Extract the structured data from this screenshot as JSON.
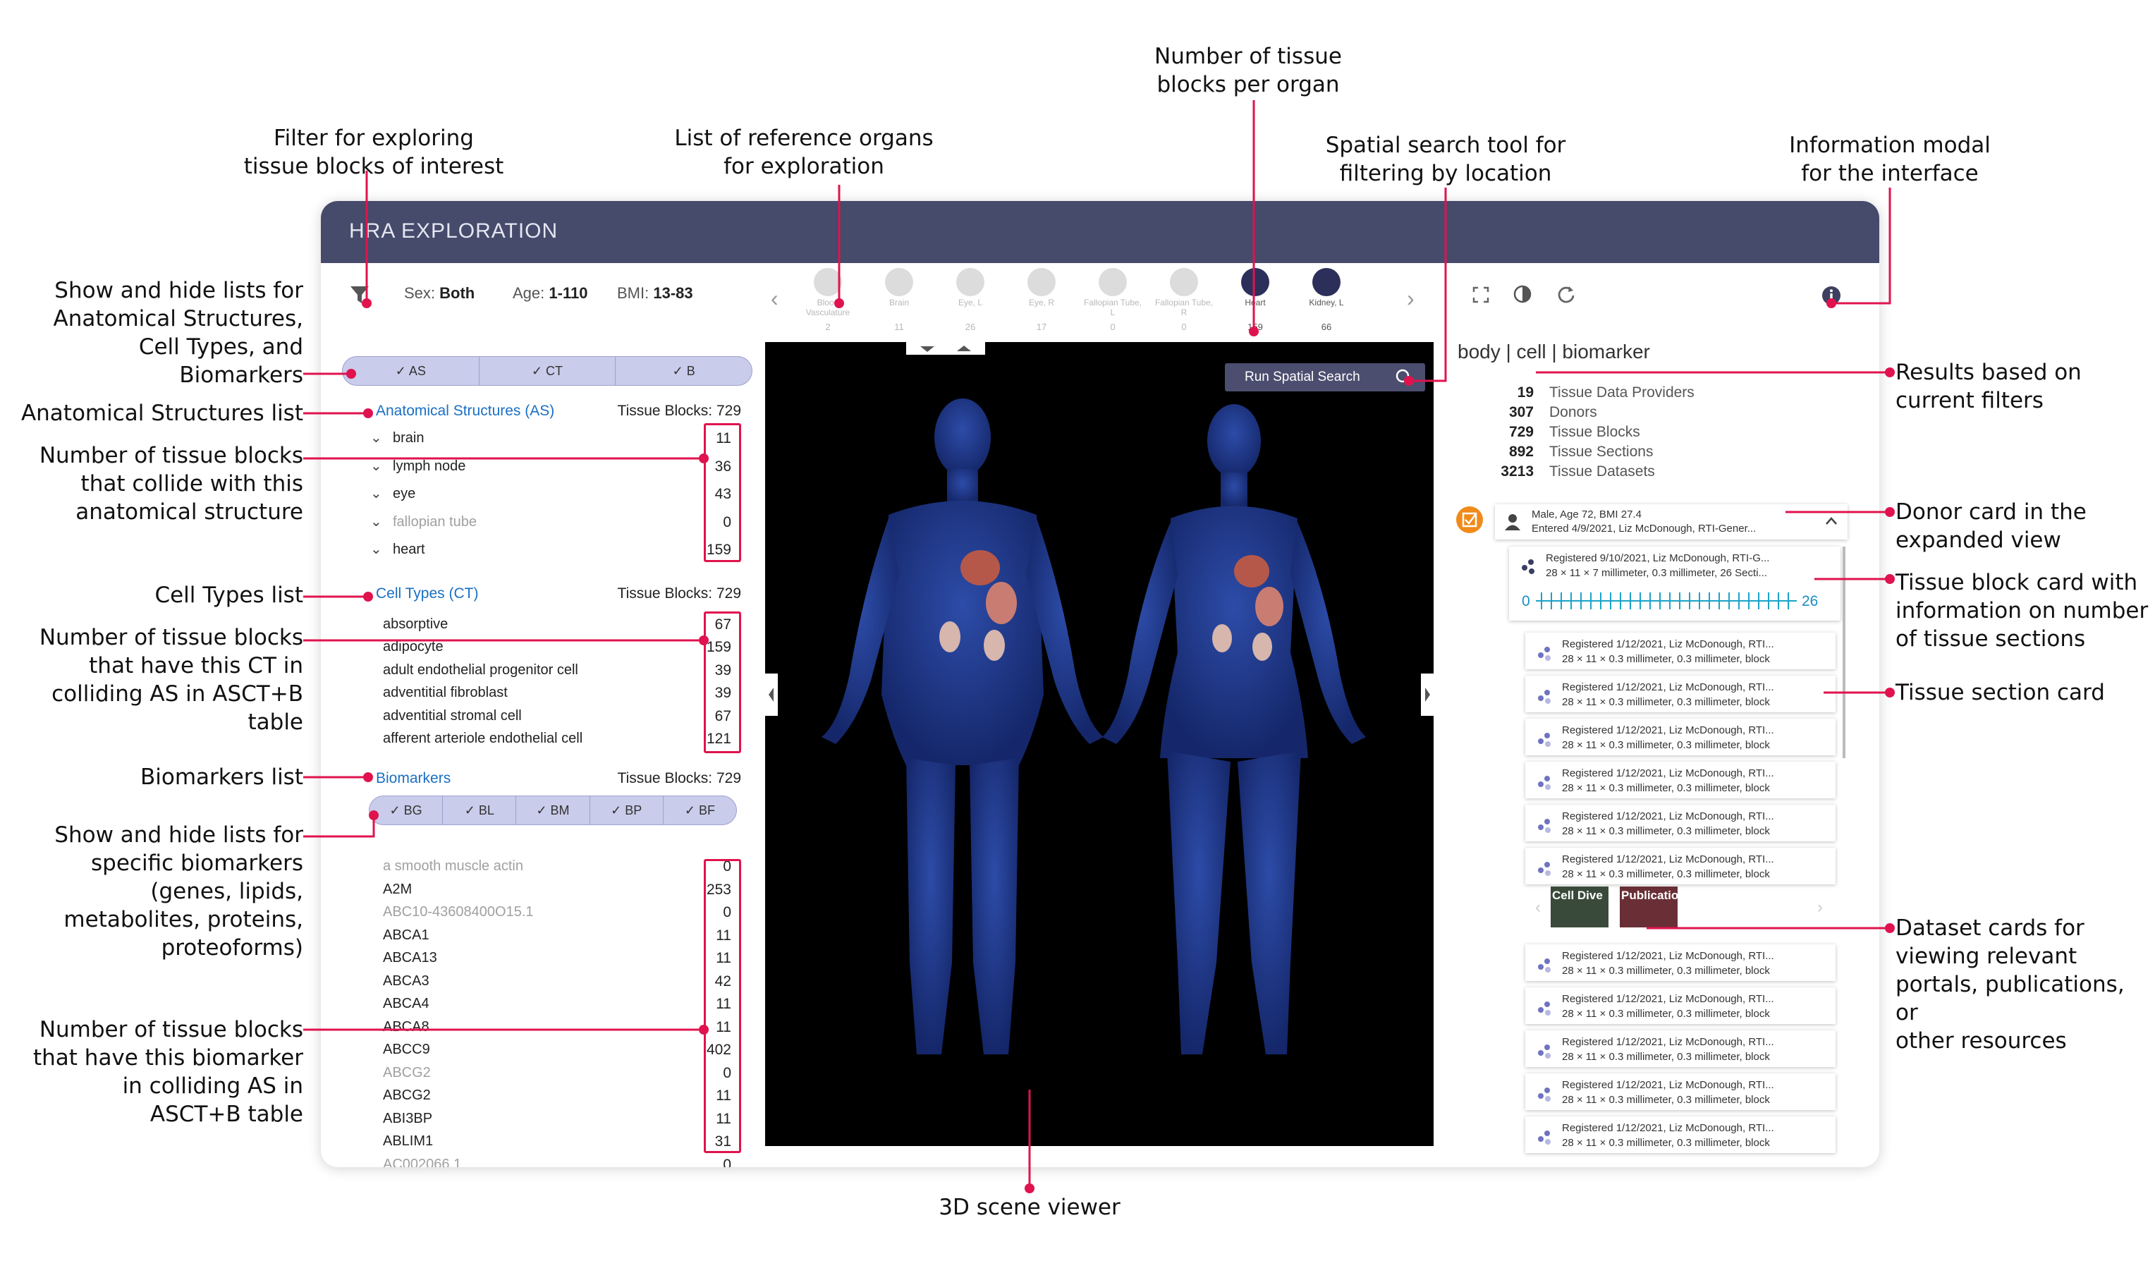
{
  "app": {
    "title": "HRA EXPLORATION"
  },
  "filters": {
    "sex_label": "Sex:",
    "sex": "Both",
    "age_label": "Age:",
    "age": "1-110",
    "bmi_label": "BMI:",
    "bmi": "13-83"
  },
  "organs": [
    {
      "name": "Blood Vasculature",
      "count": "2",
      "active": false
    },
    {
      "name": "Brain",
      "count": "11",
      "active": false
    },
    {
      "name": "Eye, L",
      "count": "26",
      "active": false
    },
    {
      "name": "Eye, R",
      "count": "17",
      "active": false
    },
    {
      "name": "Fallopian Tube, L",
      "count": "0",
      "active": false
    },
    {
      "name": "Fallopian Tube, R",
      "count": "0",
      "active": false
    },
    {
      "name": "Heart",
      "count": "159",
      "active": true
    },
    {
      "name": "Kidney, L",
      "count": "66",
      "active": true
    }
  ],
  "left": {
    "toggle_main": [
      "AS",
      "CT",
      "B"
    ],
    "as": {
      "title": "Anatomical Structures (AS)",
      "blocks": "Tissue Blocks: 729",
      "items": [
        {
          "label": "brain",
          "n": "11"
        },
        {
          "label": "lymph node",
          "n": "36"
        },
        {
          "label": "eye",
          "n": "43"
        },
        {
          "label": "fallopian tube",
          "n": "0"
        },
        {
          "label": "heart",
          "n": "159"
        }
      ]
    },
    "ct": {
      "title": "Cell Types (CT)",
      "blocks": "Tissue Blocks: 729",
      "items": [
        {
          "label": "absorptive",
          "n": "67"
        },
        {
          "label": "adipocyte",
          "n": "159"
        },
        {
          "label": "adult endothelial progenitor cell",
          "n": "39"
        },
        {
          "label": "adventitial fibroblast",
          "n": "39"
        },
        {
          "label": "adventitial stromal cell",
          "n": "67"
        },
        {
          "label": "afferent arteriole endothelial cell",
          "n": "121"
        }
      ]
    },
    "bm": {
      "title": "Biomarkers",
      "blocks": "Tissue Blocks: 729",
      "toggle": [
        "BG",
        "BL",
        "BM",
        "BP",
        "BF"
      ],
      "items": [
        {
          "label": "a smooth muscle actin",
          "n": "0"
        },
        {
          "label": "A2M",
          "n": "253"
        },
        {
          "label": "ABC10-43608400O15.1",
          "n": "0"
        },
        {
          "label": "ABCA1",
          "n": "11"
        },
        {
          "label": "ABCA13",
          "n": "11"
        },
        {
          "label": "ABCA3",
          "n": "42"
        },
        {
          "label": "ABCA4",
          "n": "11"
        },
        {
          "label": "ABCA8",
          "n": "11"
        },
        {
          "label": "ABCC9",
          "n": "402"
        },
        {
          "label": "ABCG2",
          "n": "0"
        },
        {
          "label": "ABCG2",
          "n": "11"
        },
        {
          "label": "ABI3BP",
          "n": "11"
        },
        {
          "label": "ABLIM1",
          "n": "31"
        },
        {
          "label": "AC002066.1",
          "n": "0"
        }
      ]
    }
  },
  "viewer": {
    "spatial_search": "Run Spatial Search"
  },
  "right": {
    "tabs": "body | cell | biomarker",
    "stats": [
      {
        "n": "19",
        "label": "Tissue Data Providers"
      },
      {
        "n": "307",
        "label": "Donors"
      },
      {
        "n": "729",
        "label": "Tissue Blocks"
      },
      {
        "n": "892",
        "label": "Tissue Sections"
      },
      {
        "n": "3213",
        "label": "Tissue Datasets"
      }
    ],
    "donor": {
      "line1": "Male, Age 72, BMI 27.4",
      "line2": "Entered 4/9/2021, Liz McDonough, RTI-Gener..."
    },
    "block": {
      "line1": "Registered 9/10/2021, Liz McDonough, RTI-G...",
      "line2": "28 × 11 × 7 millimeter, 0.3 millimeter, 26 Secti...",
      "min": "0",
      "max": "26"
    },
    "section": {
      "line1": "Registered 1/12/2021, Liz McDonough, RTI...",
      "line2": "28 × 11 × 0.3 millimeter, 0.3 millimeter, block"
    },
    "datasets": [
      "Cell Dive",
      "Publication"
    ]
  },
  "annotations": {
    "filter": "Filter for exploring\ntissue blocks of interest",
    "organs": "List of reference organs\nfor exploration",
    "blocks_per_organ": "Number of tissue\nblocks per organ",
    "spatial": "Spatial search tool for\nfiltering by location",
    "info": "Information modal\nfor the interface",
    "showhide": "Show and hide lists for\nAnatomical Structures,\nCell Types, and\nBiomarkers",
    "as_list": "Anatomical Structures list",
    "as_count": "Number of tissue blocks\nthat collide with this\nanatomical structure",
    "ct_list": "Cell Types list",
    "ct_count": "Number of tissue blocks\nthat have this CT in\ncolliding AS in ASCT+B\ntable",
    "bm_list": "Biomarkers list",
    "bm_showhide": "Show and hide lists for\nspecific biomarkers\n(genes, lipids,\nmetabolites, proteins,\nproteoforms)",
    "bm_count": "Number of tissue blocks\nthat have this biomarker\nin colliding AS in\nASCT+B table",
    "viewer": "3D scene viewer",
    "results": "Results based on\ncurrent filters",
    "donor": "Donor card in the\nexpanded view",
    "block": "Tissue block card with\ninformation on number\nof tissue sections",
    "section": "Tissue section card",
    "dataset": "Dataset cards for\nviewing relevant\nportals, publications, or\nother resources"
  },
  "colors": {
    "accent_red": "#e0134e",
    "titlebar": "#464a6b",
    "link_blue": "#1a6fc4",
    "body_blue": "#223a8a",
    "timeline": "#1aa3c9",
    "checkbox": "#f08a1a"
  }
}
